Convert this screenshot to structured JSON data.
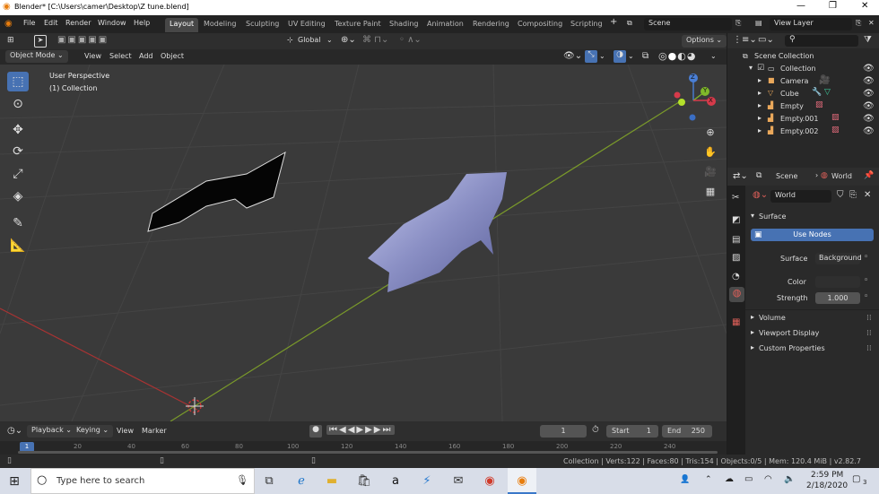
{
  "window": {
    "title": "Blender* [C:\\Users\\camer\\Desktop\\Z tune.blend]"
  },
  "menus": [
    "File",
    "Edit",
    "Render",
    "Window",
    "Help"
  ],
  "workspaces": [
    "Layout",
    "Modeling",
    "Sculpting",
    "UV Editing",
    "Texture Paint",
    "Shading",
    "Animation",
    "Rendering",
    "Compositing",
    "Scripting"
  ],
  "active_workspace": "Layout",
  "scene_field": "Scene",
  "view_layer_field": "View Layer",
  "viewport_header": {
    "orientation": "Global",
    "options": "Options"
  },
  "viewport_menu": {
    "mode": "Object Mode",
    "items": [
      "View",
      "Select",
      "Add",
      "Object"
    ]
  },
  "viewport": {
    "perspective": "User Perspective",
    "collection": "(1) Collection"
  },
  "gizmo": {
    "z": "Z",
    "y": "Y",
    "x": "X"
  },
  "outliner": {
    "scene_collection": "Scene Collection",
    "items": [
      {
        "name": "Collection"
      },
      {
        "name": "Camera"
      },
      {
        "name": "Cube"
      },
      {
        "name": "Empty"
      },
      {
        "name": "Empty.001"
      },
      {
        "name": "Empty.002"
      }
    ]
  },
  "properties": {
    "breadcrumb_scene": "Scene",
    "breadcrumb_world": "World",
    "world_name": "World",
    "surface_panel": "Surface",
    "use_nodes": "Use Nodes",
    "surface_label": "Surface",
    "surface_value": "Background",
    "color_label": "Color",
    "strength_label": "Strength",
    "strength_value": "1.000",
    "panels": [
      "Volume",
      "Viewport Display",
      "Custom Properties"
    ]
  },
  "timeline": {
    "menus": [
      "Playback",
      "Keying",
      "View",
      "Marker"
    ],
    "current_frame": "1",
    "start_label": "Start",
    "start_value": "1",
    "end_label": "End",
    "end_value": "250",
    "ruler": [
      "20",
      "40",
      "60",
      "80",
      "100",
      "120",
      "140",
      "160",
      "180",
      "200",
      "220",
      "240"
    ],
    "ruler_start": "1"
  },
  "status_bar": "Collection | Verts:122 | Faces:80 | Tris:154 | Objects:0/5 | Mem: 120.4 MiB | v2.82.7",
  "taskbar": {
    "search_placeholder": "Type here to search",
    "time": "2:59 PM",
    "date": "2/18/2020",
    "notifications": "3"
  },
  "colors": {
    "accent": "#4772b3",
    "active_row": "#334d80",
    "viewport_bg": "#3a3a3a"
  }
}
